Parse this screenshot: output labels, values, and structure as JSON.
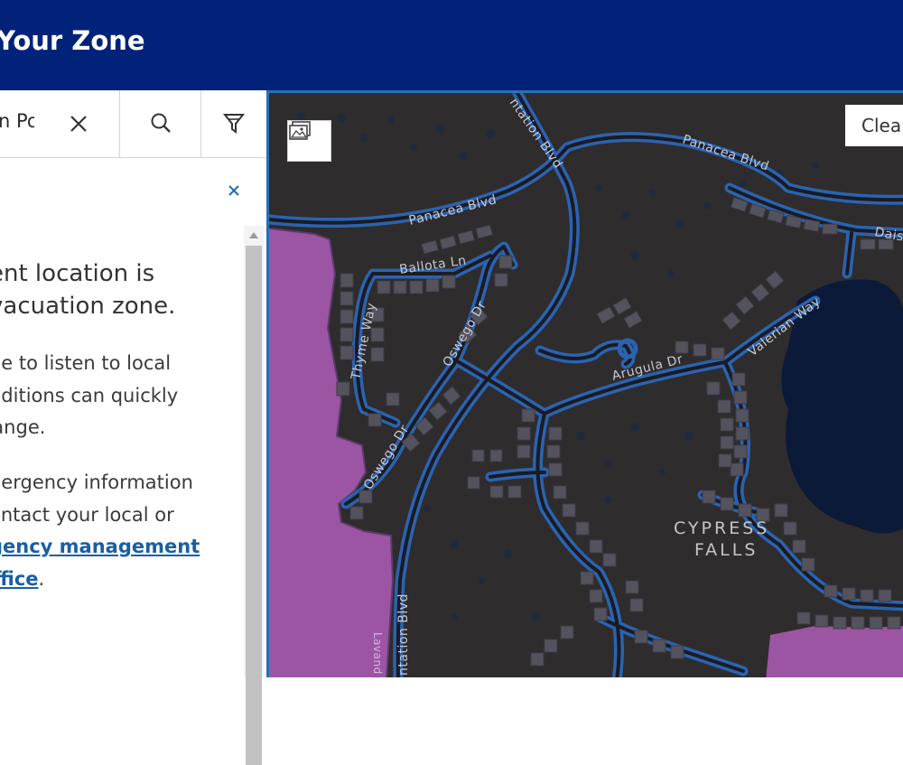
{
  "header": {
    "title": "Your Zone"
  },
  "search": {
    "value": "n Po"
  },
  "panel": {
    "heading_line1": "ent location is",
    "heading_line2": "vacuation zone.",
    "para1_line1": "ue to listen to local",
    "para1_line2": "nditions can quickly",
    "para1_line3": "hange.",
    "para2_line1": "nergency information",
    "para2_line2": "ontact your local or",
    "para2_link1": "gency management",
    "para2_link2": "office",
    "para2_period": "."
  },
  "map": {
    "clear_label": "Clear",
    "streets": {
      "panacea_blvd_1": "Panacea Blvd",
      "panacea_blvd_2": "Panacea Blvd",
      "plantation_blvd_1": "ntation Blvd",
      "plantation_blvd_2": "ntation Blvd",
      "daisy": "Dais",
      "ballota_ln": "Ballota Ln",
      "thyme_way": "Thyme Way",
      "oswego_dr_1": "Oswego Dr",
      "oswego_dr_2": "Oswego Dr",
      "valerian_way": "Valerian Way",
      "arugula_dr": "Arugula Dr",
      "lavand": "Lavand"
    },
    "place_line1": "CYPRESS",
    "place_line2": "FALLS"
  },
  "colors": {
    "header_bg": "#002379",
    "map_bg": "#2e2c2d",
    "zone_purple": "#9b55a3",
    "water": "#0b1a38",
    "road": "#2b63b0",
    "link": "#1a5fa0"
  },
  "icons": [
    "close-icon",
    "search-icon",
    "filter-icon",
    "basemap-gallery-icon",
    "scroll-up-arrow-icon"
  ]
}
